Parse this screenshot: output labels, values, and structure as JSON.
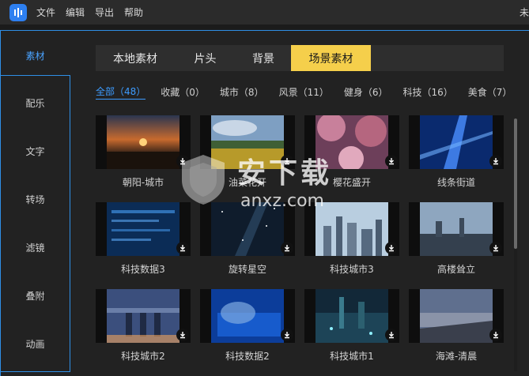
{
  "menu": {
    "items": [
      "文件",
      "编辑",
      "导出",
      "帮助"
    ],
    "right_text": "未"
  },
  "sidenav": {
    "items": [
      {
        "label": "素材",
        "active": true
      },
      {
        "label": "配乐"
      },
      {
        "label": "文字"
      },
      {
        "label": "转场"
      },
      {
        "label": "滤镜"
      },
      {
        "label": "叠附"
      },
      {
        "label": "动画"
      }
    ]
  },
  "tabs": [
    {
      "label": "本地素材"
    },
    {
      "label": "片头"
    },
    {
      "label": "背景"
    },
    {
      "label": "场景素材",
      "active": true
    }
  ],
  "filters": [
    {
      "label": "全部（48）",
      "active": true
    },
    {
      "label": "收藏（0）"
    },
    {
      "label": "城市（8）"
    },
    {
      "label": "风景（11）"
    },
    {
      "label": "健身（6）"
    },
    {
      "label": "科技（16）"
    },
    {
      "label": "美食（7）"
    }
  ],
  "cards": [
    {
      "label": "朝阳-城市",
      "thumb": "sunset"
    },
    {
      "label": "油菜花开",
      "thumb": "field"
    },
    {
      "label": "樱花盛开",
      "thumb": "sakura"
    },
    {
      "label": "线条街道",
      "thumb": "lines"
    },
    {
      "label": "科技数据3",
      "thumb": "tech"
    },
    {
      "label": "旋转星空",
      "thumb": "stars"
    },
    {
      "label": "科技城市3",
      "thumb": "citybright"
    },
    {
      "label": "高楼耸立",
      "thumb": "skyline"
    },
    {
      "label": "科技城市2",
      "thumb": "marina"
    },
    {
      "label": "科技数据2",
      "thumb": "keyboard"
    },
    {
      "label": "科技城市1",
      "thumb": "citynight"
    },
    {
      "label": "海滩-清晨",
      "thumb": "beach"
    }
  ],
  "watermark": {
    "title": "安下载",
    "url": "anxz.com"
  },
  "colors": {
    "accent": "#2f8fe6",
    "tab_active": "#f5cf4b",
    "filter_active": "#3d9cff"
  }
}
